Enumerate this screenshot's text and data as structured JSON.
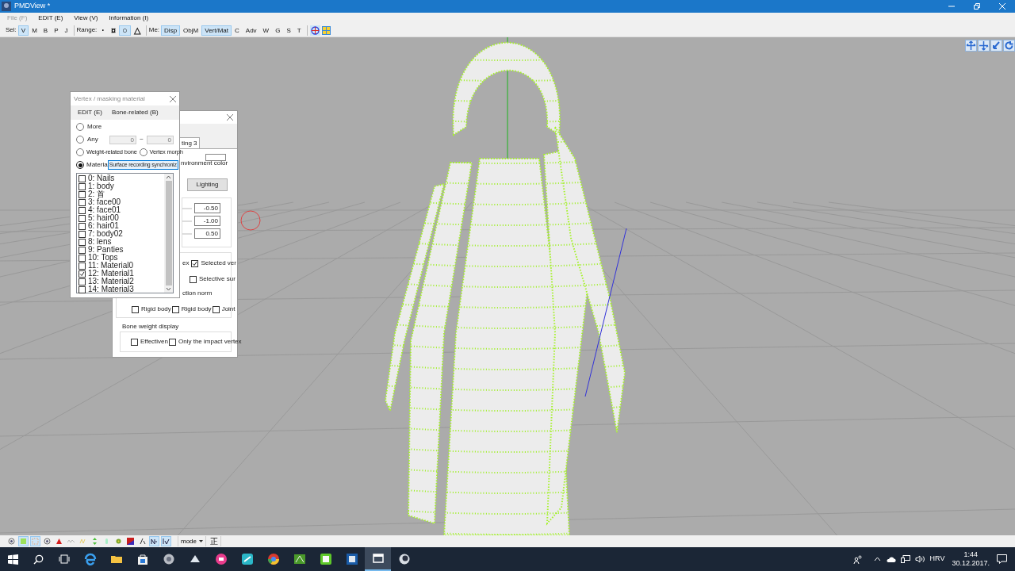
{
  "window": {
    "title": "PMDView *"
  },
  "menu": [
    {
      "label": "File (F)",
      "disabled": true
    },
    {
      "label": "EDIT (E)",
      "disabled": false
    },
    {
      "label": "View (V)",
      "disabled": false
    },
    {
      "label": "Information (I)",
      "disabled": false
    }
  ],
  "toolbar": [
    {
      "label": "Sel:",
      "buttons": [
        {
          "label": "V",
          "selected": true
        },
        {
          "label": "M",
          "selected": false
        },
        {
          "label": "B",
          "selected": false
        },
        {
          "label": "P",
          "selected": false
        },
        {
          "label": "J",
          "selected": false
        }
      ]
    },
    {
      "label": "Range:",
      "buttons": [
        {
          "label": "·",
          "selected": false
        },
        {
          "label": "¤",
          "selected": false
        },
        {
          "label": "○",
          "selected": true
        },
        {
          "label": "△",
          "selected": false
        }
      ]
    },
    {
      "label": "Me:",
      "buttons": [
        {
          "label": "Disp",
          "selected": true
        },
        {
          "label": "ObjM",
          "selected": false
        },
        {
          "label": "Vert/Mat",
          "selected": true
        },
        {
          "label": "C",
          "selected": false
        },
        {
          "label": "Adv",
          "selected": false
        },
        {
          "label": "W",
          "selected": false
        },
        {
          "label": "G",
          "selected": false
        },
        {
          "label": "S",
          "selected": false
        },
        {
          "label": "T",
          "selected": false
        }
      ]
    }
  ],
  "material_dialog": {
    "tab": "ting 3",
    "environment_label": "nvironment color",
    "lighting_button": "Lighting",
    "values": [
      "-0.50",
      "-1.00",
      "0.50"
    ],
    "vertex_label": "ex",
    "selected_vertex": {
      "label": "Selected ver",
      "checked": true
    },
    "selective_surface": {
      "label": "Selective sur",
      "checked": false
    },
    "normal_label": "ction norm",
    "display_checks": [
      {
        "label": "Rigid body",
        "checked": false
      },
      {
        "label": "Rigid body",
        "checked": false
      },
      {
        "label": "Joint",
        "checked": false
      }
    ],
    "bone_weight": {
      "title": "Bone weight display",
      "checks": [
        {
          "label": "Effectiven",
          "checked": false
        },
        {
          "label": "Only the impact vertex",
          "checked": false
        }
      ]
    }
  },
  "mask_dialog": {
    "title": "Vertex / masking material",
    "menu": [
      "EDIT (E)",
      "Bone-related (B)"
    ],
    "more": {
      "label": "More",
      "selected": false
    },
    "any": {
      "label": "Any",
      "selected": false,
      "from": "0",
      "separator": "~",
      "to": "0"
    },
    "weight_bone": {
      "label": "Weight-related bone",
      "selected": false
    },
    "vertex_morph": {
      "label": "Vertex morph",
      "selected": false
    },
    "material": {
      "label": "Materia",
      "selected": true,
      "value": "Surface recording synchroniz"
    },
    "materials": [
      {
        "label": "0: Nails",
        "checked": false
      },
      {
        "label": "1: body",
        "checked": false
      },
      {
        "label": "2: 首",
        "checked": false
      },
      {
        "label": "3: face00",
        "checked": false
      },
      {
        "label": "4: face01",
        "checked": false
      },
      {
        "label": "5: hair00",
        "checked": false
      },
      {
        "label": "6: hair01",
        "checked": false
      },
      {
        "label": "7: body02",
        "checked": false
      },
      {
        "label": "8: lens",
        "checked": false
      },
      {
        "label": "9: Panties",
        "checked": false
      },
      {
        "label": "10: Tops",
        "checked": false
      },
      {
        "label": "11: Material0",
        "checked": false
      },
      {
        "label": "12: Material1",
        "checked": true
      },
      {
        "label": "13: Material2",
        "checked": false
      },
      {
        "label": "14: Material3",
        "checked": false
      }
    ]
  },
  "bottom_toolbar": {
    "toggles": [
      {
        "kind": "dot",
        "selected": false
      },
      {
        "kind": "fill",
        "selected": true
      },
      {
        "kind": "frame",
        "selected": true
      },
      {
        "kind": "dot",
        "selected": false
      },
      {
        "kind": "triangle",
        "selected": false
      },
      {
        "kind": "wave",
        "selected": false
      },
      {
        "kind": "zigzag",
        "selected": false
      },
      {
        "kind": "arrows",
        "selected": false
      },
      {
        "kind": "capsule",
        "selected": false
      },
      {
        "kind": "flower",
        "selected": false
      },
      {
        "kind": "square",
        "selected": false
      },
      {
        "kind": "slash",
        "selected": false
      },
      {
        "kind": "normal",
        "selected": true
      },
      {
        "kind": "edge",
        "selected": true
      }
    ],
    "mode": "mode",
    "flip": "正"
  },
  "taskbar": {
    "apps": [
      {
        "kind": "browser",
        "active": false
      },
      {
        "kind": "folder",
        "active": false
      },
      {
        "kind": "bag",
        "active": false
      },
      {
        "kind": "disc",
        "active": false
      },
      {
        "kind": "steam",
        "active": false
      },
      {
        "kind": "record",
        "active": false
      },
      {
        "kind": "pen",
        "active": false
      },
      {
        "kind": "round",
        "active": false
      },
      {
        "kind": "mountain",
        "active": false
      },
      {
        "kind": "tile",
        "active": false
      },
      {
        "kind": "panel",
        "active": false
      },
      {
        "kind": "window",
        "active": true
      },
      {
        "kind": "dark",
        "active": false
      }
    ],
    "language": "HRV",
    "time": "1:44",
    "date": "30.12.2017."
  }
}
